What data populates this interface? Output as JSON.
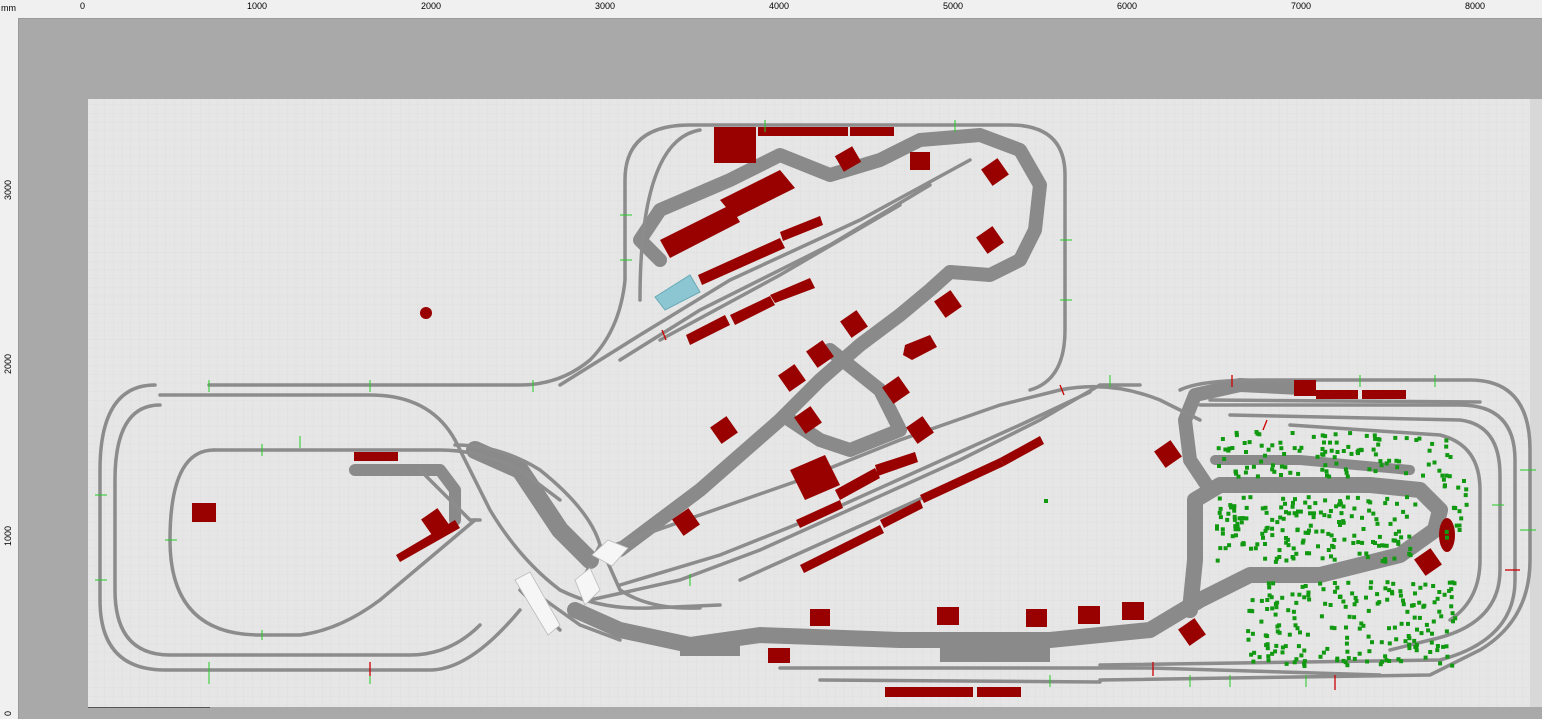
{
  "ruler": {
    "unit": "mm",
    "x_labels": [
      "0",
      "1000",
      "2000",
      "3000",
      "4000",
      "5000",
      "6000",
      "7000",
      "8000"
    ],
    "y_labels": [
      "3000",
      "2000",
      "1000",
      "0"
    ]
  },
  "colors": {
    "board": "#e6e6e6",
    "grid": "#d6d6d6",
    "track": "#8c8c8c",
    "road": "#8a8a8a",
    "building": "#990000",
    "tree": "#119911",
    "water": "#8cc6d2",
    "joint": "#22cc22",
    "signal": "#cc0000"
  }
}
